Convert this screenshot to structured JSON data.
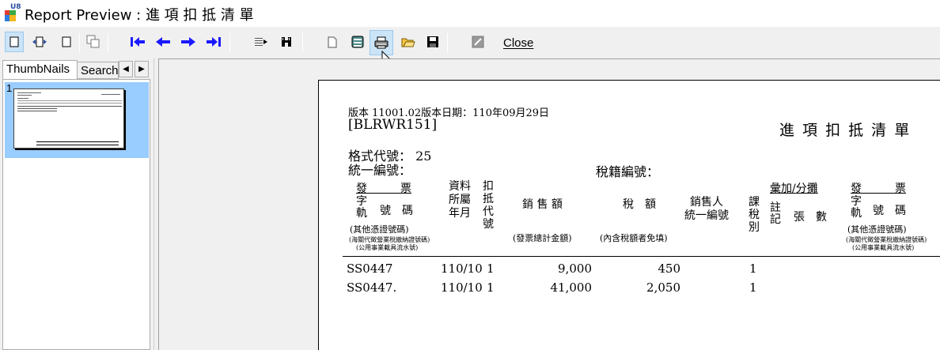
{
  "window": {
    "title": "Report Preview : 進 項 扣 抵 清 單"
  },
  "toolbar": {
    "close_label": "Close"
  },
  "left_panel": {
    "tabs": [
      "ThumbNails",
      "Search"
    ],
    "thumbnail_page_number": "1"
  },
  "report": {
    "version_line": "版本 11001.02版本日期：110年09月29日",
    "report_code": "[BLRWR151]",
    "title": "進 項 扣 抵 清 單",
    "format_code_label": "格式代號： 25",
    "unified_no_label": "統一編號：",
    "tax_registration_label": "稅籍編號：",
    "headers": {
      "invoice_group": "發　　　票",
      "invoice_track": "字\n軌",
      "invoice_number": "號　碼",
      "other_proof": "(其他憑證號碼)",
      "customs_note": "(海關代徵營業稅繳納證號碼)",
      "utility_note": "(公用事業載具流水號)",
      "period": "資料\n所屬\n年月",
      "deduction_code": "扣\n抵\n代\n號",
      "sales_amount": "銷 售 額",
      "sales_amount_note": "(發票總計金額)",
      "tax_amount": "稅　額",
      "tax_amount_note": "(內含稅額者免填)",
      "seller_id": "銷售人\n統一編號",
      "taxable_type": "課\n稅\n別",
      "aggregate_group": "彙加/分攤",
      "note_mark": "註\n記",
      "sheet_count": "張　數",
      "invoice_group_2": "發　　　票",
      "invoice_track_2": "字\n軌",
      "invoice_number_2": "號　碼",
      "other_proof_2": "(其他憑證號碼)",
      "customs_note_2": "(海關代徵營業稅繳納證號碼)",
      "utility_note_2": "(公用事業載具流水號)"
    },
    "rows": [
      {
        "invoice": "SS0447",
        "period": "110/10",
        "code": "1",
        "sales": "9,000",
        "tax": "450",
        "type": "1"
      },
      {
        "invoice": "SS0447.",
        "period": "110/10",
        "code": "1",
        "sales": "41,000",
        "tax": "2,050",
        "type": "1"
      }
    ]
  },
  "icons": {
    "toolbar": [
      "single-page-icon",
      "page-width-icon",
      "whole-page-icon",
      "multi-page-icon",
      "first-page-icon",
      "previous-page-icon",
      "next-page-icon",
      "last-page-icon",
      "goto-page-icon",
      "find-icon",
      "new-icon",
      "export-icon",
      "print-icon",
      "open-icon",
      "save-icon",
      "zoom-icon"
    ]
  }
}
